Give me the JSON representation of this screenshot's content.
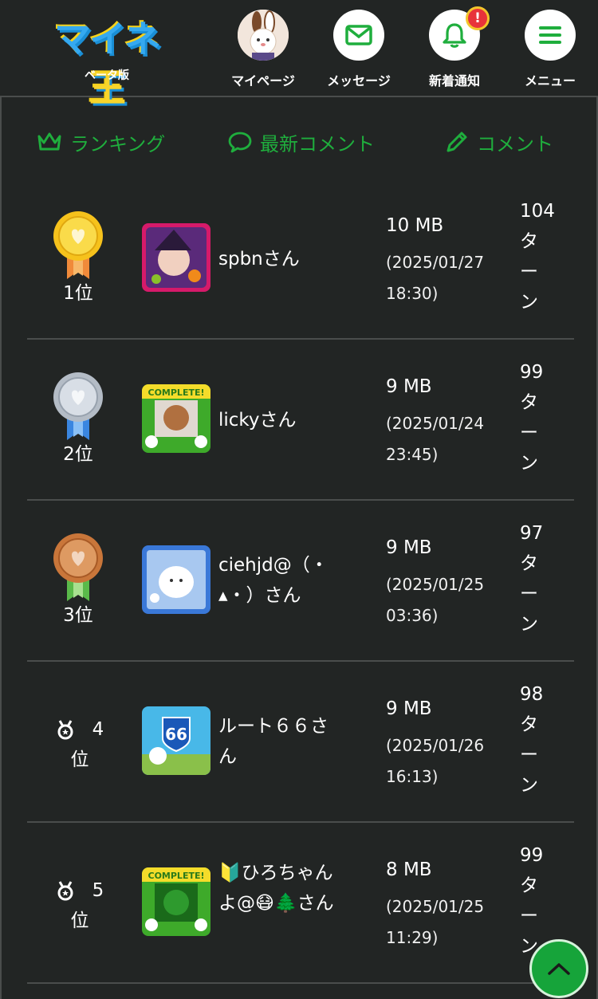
{
  "header": {
    "logo": {
      "title": "マイネ王",
      "subtitle": "ベータ版"
    },
    "nav": [
      {
        "label": "マイページ",
        "icon": "avatar"
      },
      {
        "label": "メッセージ",
        "icon": "envelope-icon"
      },
      {
        "label": "新着通知",
        "icon": "bell-icon",
        "badge": "!"
      },
      {
        "label": "メニュー",
        "icon": "hamburger-icon"
      }
    ]
  },
  "tabs": [
    {
      "label": "ランキング",
      "icon": "crown-icon"
    },
    {
      "label": "最新コメント",
      "icon": "speech-bubble-icon"
    },
    {
      "label": "コメント",
      "icon": "pencil-icon"
    }
  ],
  "rows": [
    {
      "rank": "1位",
      "name": "spbnさん",
      "size": "10 MB",
      "date": "(2025/01/27 18:30)",
      "turns": [
        "104",
        "タ",
        "ー",
        "ン"
      ]
    },
    {
      "rank": "2位",
      "name": "lickyさん",
      "size": "9 MB",
      "date": "(2025/01/24 23:45)",
      "turns": [
        "99",
        "タ",
        "ー",
        "ン"
      ]
    },
    {
      "rank": "3位",
      "name": "ciehjd@（・▴・）さん",
      "size": "9 MB",
      "date": "(2025/01/25 03:36)",
      "turns": [
        "97",
        "タ",
        "ー",
        "ン"
      ]
    },
    {
      "rank_num": "4",
      "rank_suffix": "位",
      "name": "ルート６６さん",
      "size": "9 MB",
      "date": "(2025/01/26 16:13)",
      "turns": [
        "98",
        "タ",
        "ー",
        "ン"
      ]
    },
    {
      "rank_num": "5",
      "rank_suffix": "位",
      "name": "🔰ひろちゃんよ@😷🌲さん",
      "size": "8 MB",
      "date": "(2025/01/25 11:29)",
      "turns": [
        "99",
        "タ",
        "ー",
        "ン"
      ]
    }
  ],
  "colors": {
    "background": "#222524",
    "accent": "#1fae3d",
    "divider": "#4a4d4c"
  }
}
